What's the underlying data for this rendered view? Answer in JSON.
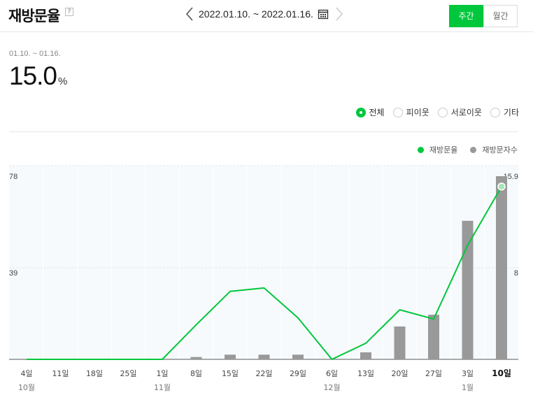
{
  "header": {
    "title": "재방문율",
    "help_label": "?",
    "date_range": "2022.01.10. ~ 2022.01.16.",
    "toggle": [
      {
        "label": "주간",
        "active": true
      },
      {
        "label": "월간",
        "active": false
      }
    ]
  },
  "summary": {
    "period": "01.10. ~ 01.16.",
    "value": "15.0",
    "unit": "%"
  },
  "filters": [
    {
      "label": "전체",
      "selected": true
    },
    {
      "label": "피이웃",
      "selected": false
    },
    {
      "label": "서로이웃",
      "selected": false
    },
    {
      "label": "기타",
      "selected": false
    }
  ],
  "legend": [
    {
      "label": "재방문율",
      "color": "#00c73c"
    },
    {
      "label": "재방문자수",
      "color": "#999999"
    }
  ],
  "colors": {
    "accent": "#00c73c",
    "bar": "#999999"
  },
  "chart_data": {
    "type": "bar",
    "categories": [
      "4일",
      "11일",
      "18일",
      "25일",
      "1일",
      "8일",
      "15일",
      "22일",
      "29일",
      "6일",
      "13일",
      "20일",
      "27일",
      "3일",
      "10일"
    ],
    "month_labels": [
      {
        "index": 0,
        "label": "10월"
      },
      {
        "index": 4,
        "label": "11월"
      },
      {
        "index": 9,
        "label": "12월"
      },
      {
        "index": 13,
        "label": "1월"
      }
    ],
    "left_axis_ticks": [
      "78",
      "39"
    ],
    "right_axis_ticks": [
      "15.9",
      "8"
    ],
    "series": [
      {
        "name": "재방문자수",
        "type": "bar",
        "axis": "left",
        "values": [
          0,
          0,
          0,
          0,
          0,
          1,
          2,
          2,
          2,
          0,
          3,
          14,
          19,
          59,
          78
        ]
      },
      {
        "name": "재방문율",
        "type": "line",
        "axis": "right",
        "values": [
          0,
          0,
          0,
          0,
          0,
          3.0,
          5.9,
          6.2,
          3.6,
          0,
          1.4,
          4.3,
          3.5,
          9.9,
          15.0
        ]
      }
    ],
    "ylim_left": [
      0,
      78
    ],
    "ylim_right": [
      0,
      15.9
    ]
  }
}
